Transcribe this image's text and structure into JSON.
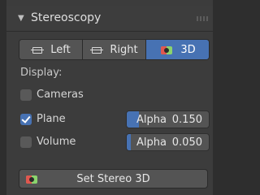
{
  "panel": {
    "title": "Stereoscopy",
    "collapse_icon": "▼"
  },
  "eye_selector": {
    "options": [
      {
        "label": "Left",
        "icon": "camera-icon",
        "active": false
      },
      {
        "label": "Right",
        "icon": "camera-icon",
        "active": false
      },
      {
        "label": "3D",
        "icon": "stereo-camera-icon",
        "active": true
      }
    ]
  },
  "display": {
    "label": "Display:",
    "cameras": {
      "label": "Cameras",
      "checked": false
    },
    "plane": {
      "label": "Plane",
      "checked": true,
      "alpha_label": "Alpha",
      "alpha_value": "0.150",
      "alpha_fraction": 0.15
    },
    "volume": {
      "label": "Volume",
      "checked": false,
      "alpha_label": "Alpha",
      "alpha_value": "0.050",
      "alpha_fraction": 0.05
    }
  },
  "set_stereo_button": {
    "label": "Set Stereo 3D",
    "icon": "stereo-camera-icon"
  },
  "colors": {
    "accent": "#4772b3",
    "panel_bg": "#3c3c3c",
    "button_bg": "#545454"
  }
}
